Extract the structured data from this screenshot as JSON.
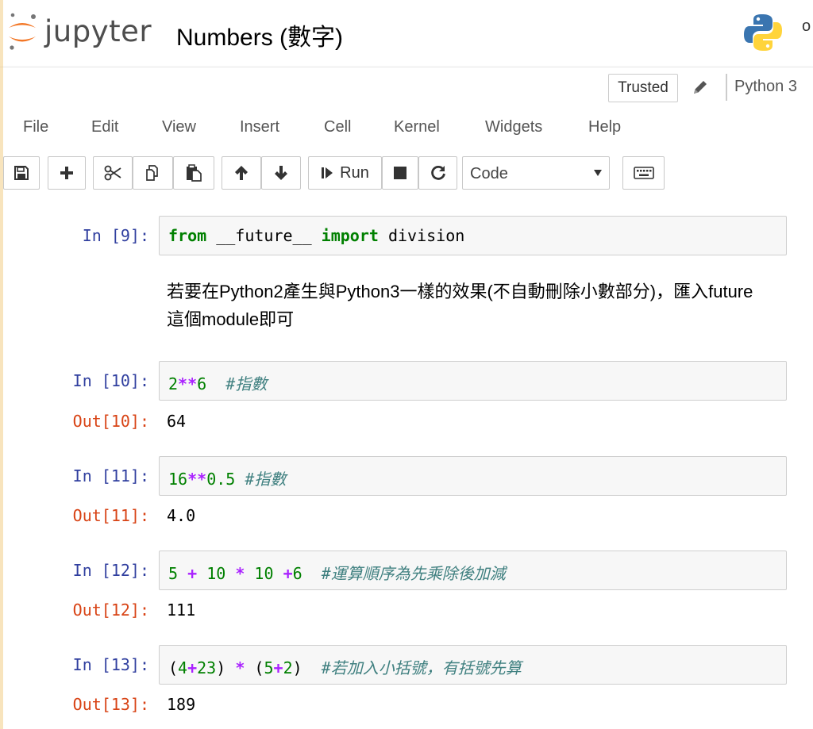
{
  "header": {
    "wordmark": "jupyter",
    "notebook_title": "Numbers (數字)",
    "user_fragment": "o"
  },
  "kernel_bar": {
    "trusted_label": "Trusted",
    "kernel_name": "Python 3"
  },
  "menu": [
    "File",
    "Edit",
    "View",
    "Insert",
    "Cell",
    "Kernel",
    "Widgets",
    "Help"
  ],
  "toolbar": {
    "run_label": "Run",
    "cell_type": "Code"
  },
  "cells": [
    {
      "prompt": "In [9]:",
      "code": {
        "t0": "from",
        "t1": " __future__ ",
        "t2": "import",
        "t3": " division"
      }
    },
    {
      "markdown": "若要在Python2產生與Python3一樣的效果(不自動刪除小數部分)，匯入future這個module即可"
    },
    {
      "prompt": "In [10]:",
      "code": {
        "t0": "2",
        "t1": "**",
        "t2": "6",
        "t3": "  ",
        "t4": "#指數"
      },
      "out_prompt": "Out[10]:",
      "output": "64"
    },
    {
      "prompt": "In [11]:",
      "code": {
        "t0": "16",
        "t1": "**",
        "t2": "0.5",
        "t3": " ",
        "t4": "#指數"
      },
      "out_prompt": "Out[11]:",
      "output": "4.0"
    },
    {
      "prompt": "In [12]:",
      "code": {
        "t0": "5",
        "t1": " ",
        "t2": "+",
        "t3": " ",
        "t4": "10",
        "t5": " ",
        "t6": "*",
        "t7": " ",
        "t8": "10",
        "t9": " ",
        "t10": "+",
        "t11": "6",
        "t12": "  ",
        "t13": "#運算順序為先乘除後加減"
      },
      "out_prompt": "Out[12]:",
      "output": "111"
    },
    {
      "prompt": "In [13]:",
      "code": {
        "t0": "(",
        "t1": "4",
        "t2": "+",
        "t3": "23",
        "t4": ")",
        "t5": " ",
        "t6": "*",
        "t7": " ",
        "t8": "(",
        "t9": "5",
        "t10": "+",
        "t11": "2",
        "t12": ")",
        "t13": "  ",
        "t14": "#若加入小括號，有括號先算"
      },
      "out_prompt": "Out[13]:",
      "output": "189"
    }
  ]
}
